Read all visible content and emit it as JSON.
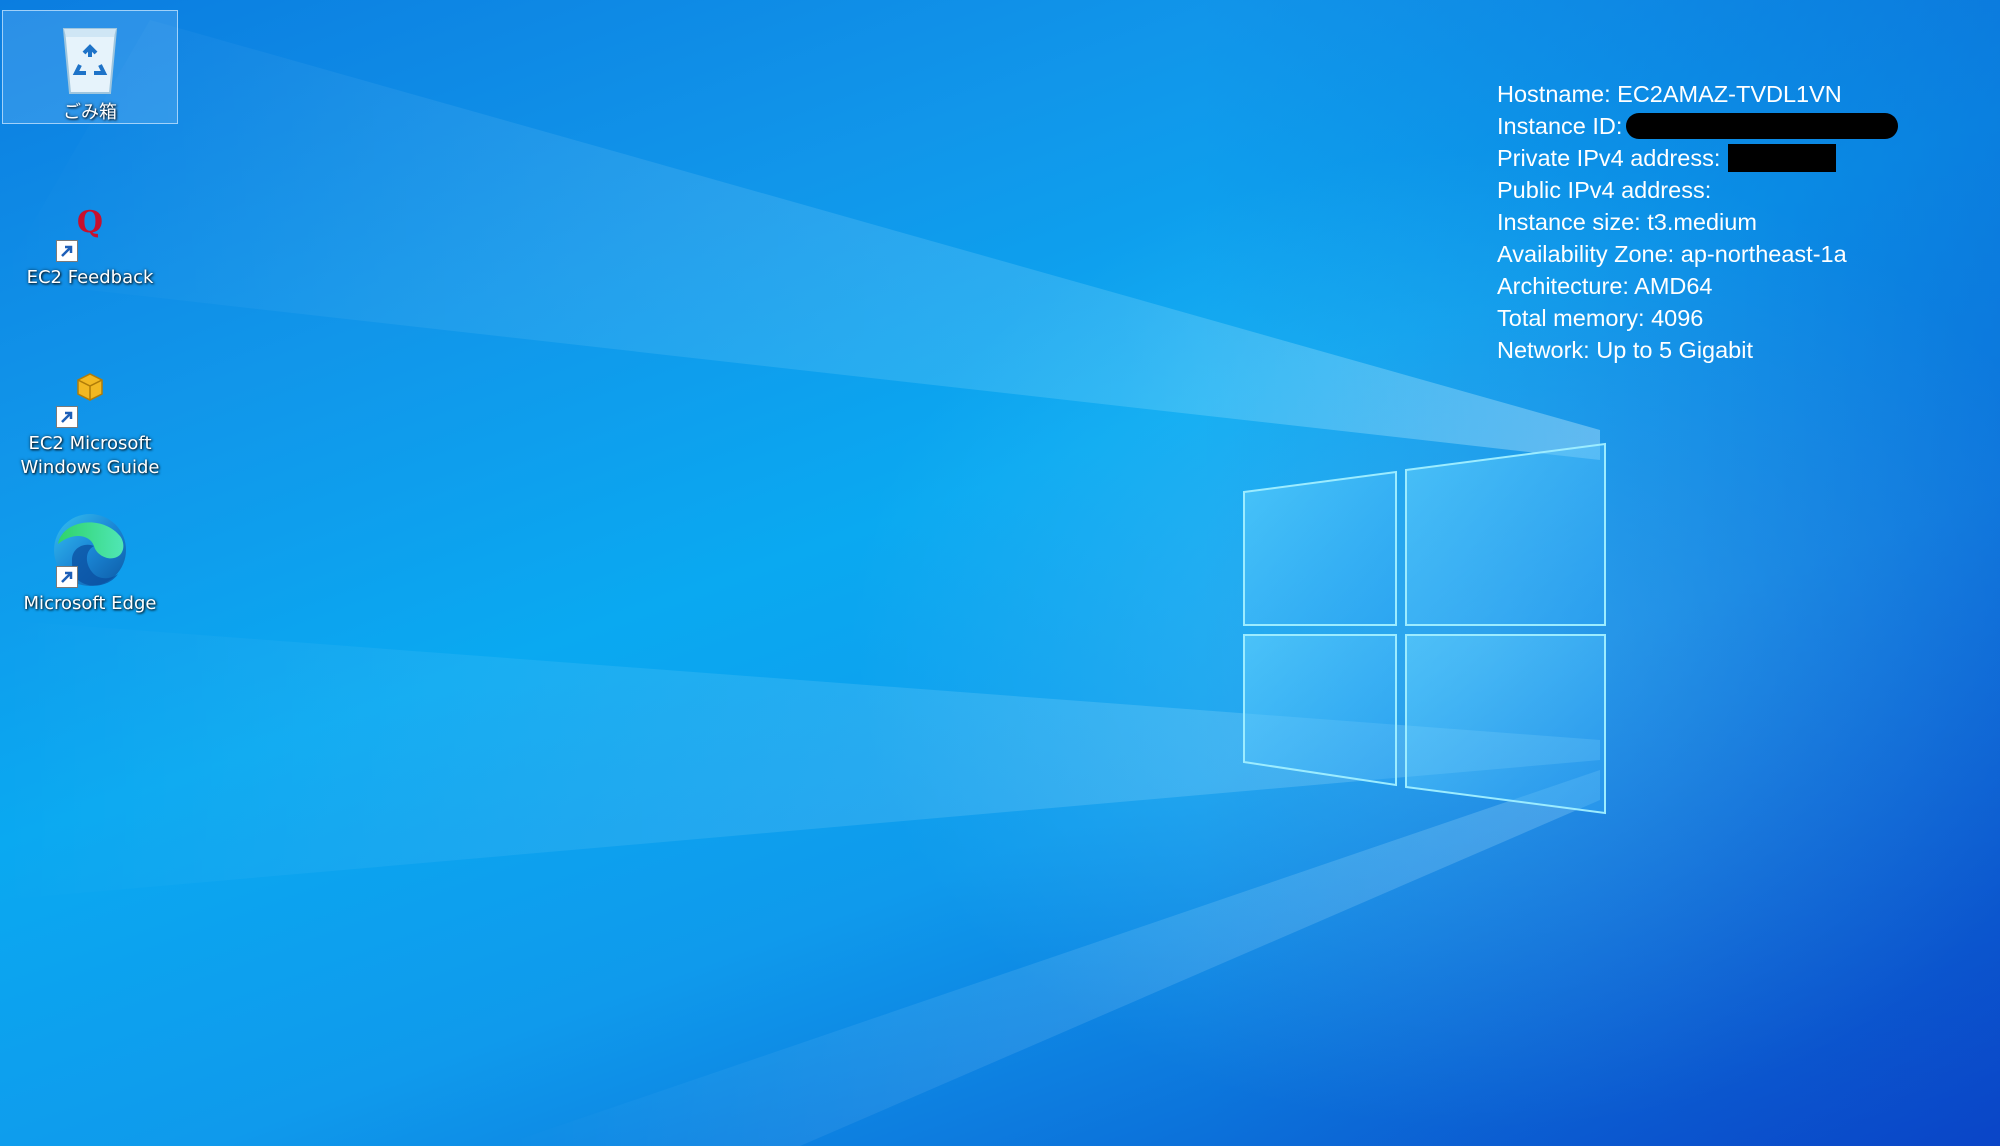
{
  "desktop": {
    "icons": [
      {
        "label": "ごみ箱",
        "icon": "recycle-bin-icon",
        "shortcut": false,
        "selected": true
      },
      {
        "label": "EC2 Feedback",
        "icon": "feedback-q-icon",
        "shortcut": true,
        "selected": false
      },
      {
        "label": "EC2 Microsoft\nWindows Guide",
        "icon": "guide-package-icon",
        "shortcut": true,
        "selected": false
      },
      {
        "label": "Microsoft Edge",
        "icon": "edge-browser-icon",
        "shortcut": true,
        "selected": false
      }
    ]
  },
  "bginfo": {
    "hostname": "Hostname: EC2AMAZ-TVDL1VN",
    "instance_id_label": "Instance ID:",
    "private_ipv4_label": "Private IPv4 address:",
    "public_ipv4": "Public IPv4 address:",
    "instance_size": "Instance size: t3.medium",
    "availability_zone": "Availability Zone: ap-northeast-1a",
    "architecture": "Architecture: AMD64",
    "total_memory": "Total memory: 4096",
    "network": "Network: Up to 5 Gigabit"
  },
  "colors": {
    "wallpaper_primary": "#0aa9f1",
    "wallpaper_deep": "#0a4fcc",
    "text": "#ffffff",
    "redaction": "#000000"
  }
}
